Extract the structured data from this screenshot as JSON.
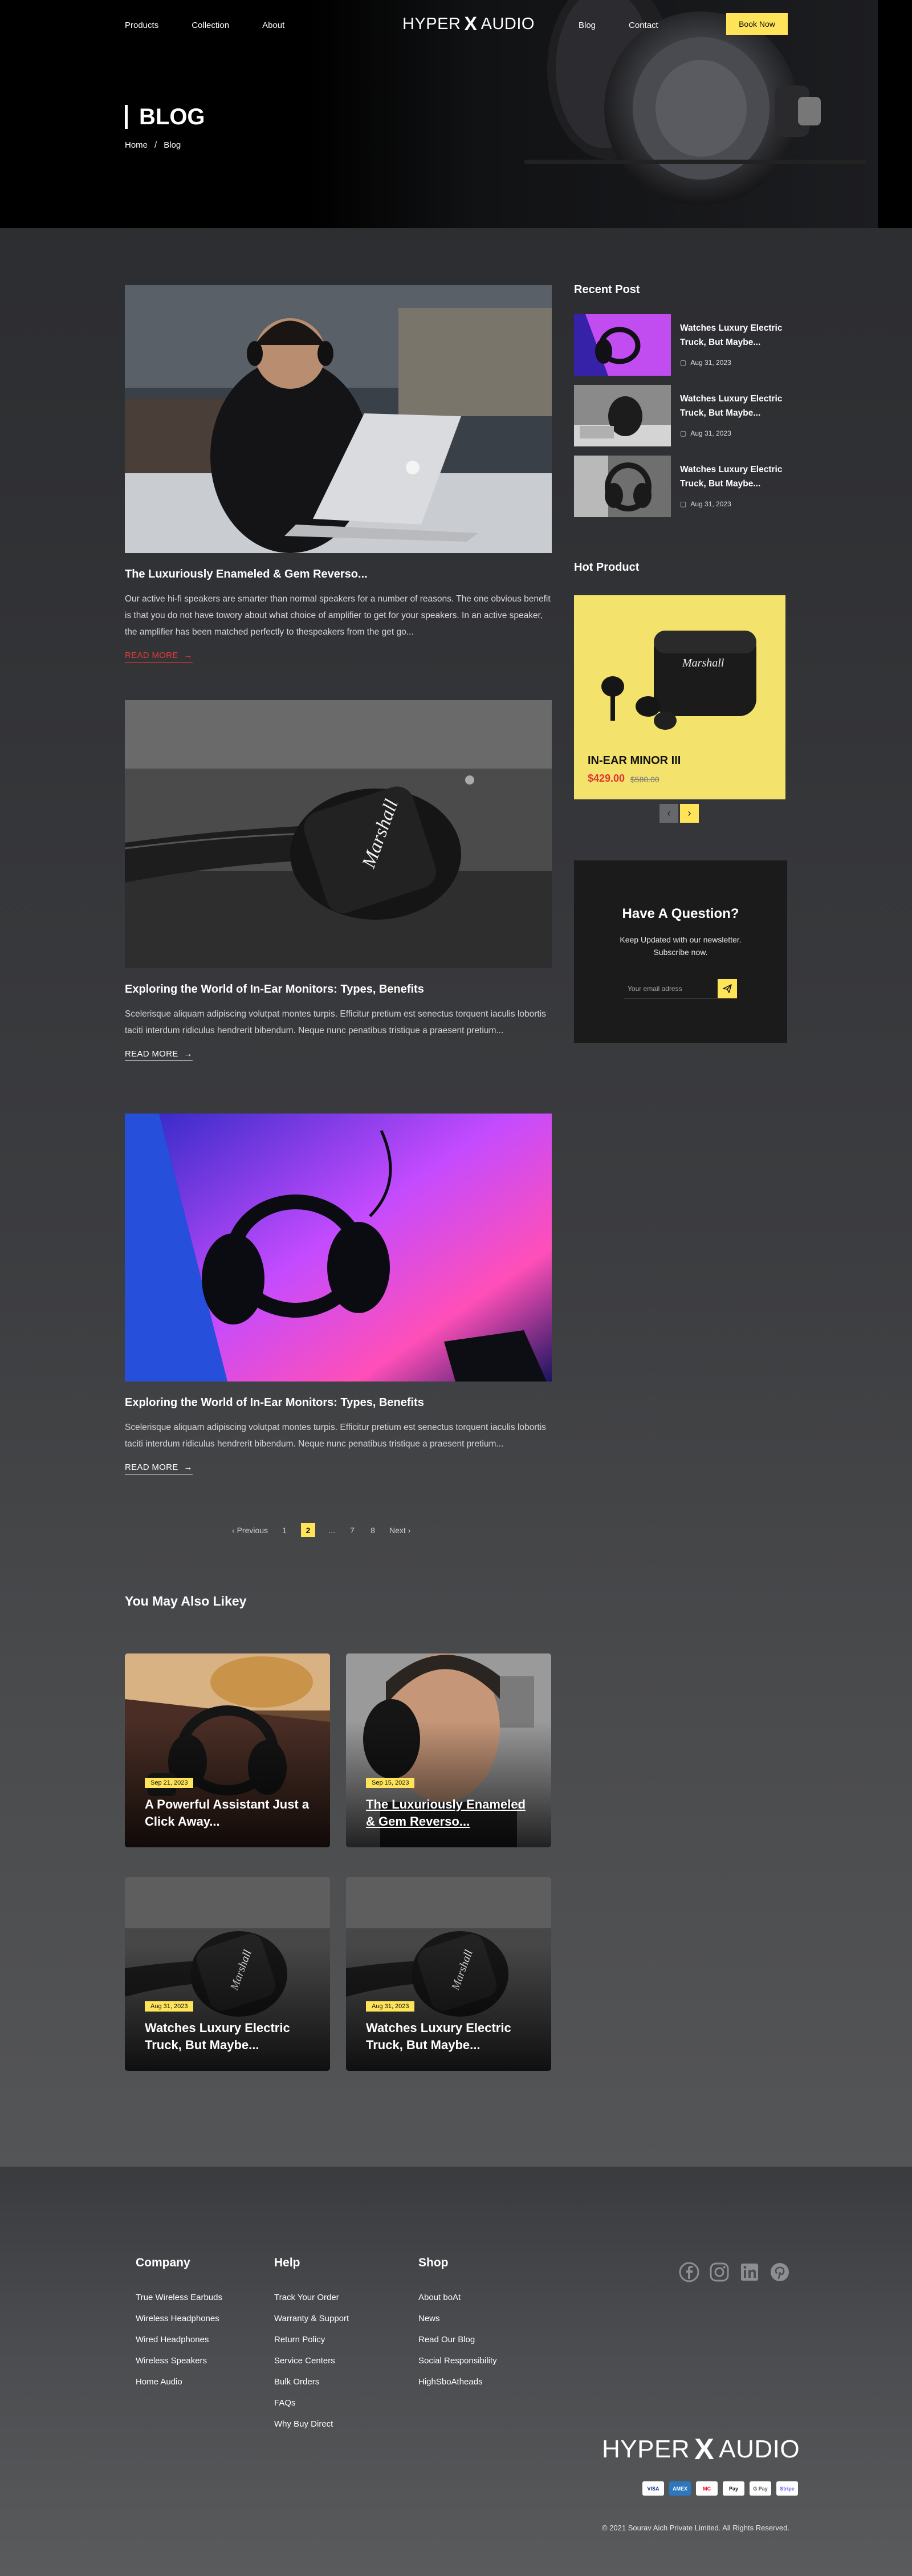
{
  "header": {
    "nav_left": [
      "Products",
      "Collection",
      "About"
    ],
    "nav_right": [
      "Blog",
      "Contact"
    ],
    "logo_left": "HYPER",
    "logo_mark": "X",
    "logo_right": "AUDIO",
    "cta": "Book Now"
  },
  "hero": {
    "title": "BLOG",
    "breadcrumb": [
      "Home",
      "/",
      "Blog"
    ]
  },
  "posts": [
    {
      "title": "The Luxuriously Enameled & Gem Reverso...",
      "excerpt": "Our active hi-fi speakers are smarter than normal speakers for a number of reasons. The one obvious benefit is that you do not have towory about what choice of amplifier to get for your speakers. In an active speaker, the amplifier has been matched perfectly to thespeakers from the get go...",
      "read_more": "READ MORE"
    },
    {
      "title": "Exploring the World of In-Ear Monitors: Types, Benefits",
      "excerpt": "Scelerisque aliquam adipiscing volutpat montes turpis. Efficitur pretium est senectus torquent iaculis lobortis taciti interdum ridiculus hendrerit bibendum. Neque nunc penatibus tristique a praesent pretium...",
      "read_more": "READ MORE"
    },
    {
      "title": "Exploring the World of In-Ear Monitors: Types, Benefits",
      "excerpt": "Scelerisque aliquam adipiscing volutpat montes turpis. Efficitur pretium est senectus torquent iaculis lobortis taciti interdum ridiculus hendrerit bibendum. Neque nunc penatibus tristique a praesent pretium...",
      "read_more": "READ MORE"
    }
  ],
  "pagination": {
    "previous": "Previous",
    "pages": [
      "1",
      "2",
      "...",
      "7",
      "8"
    ],
    "current": "2",
    "next": "Next"
  },
  "sidebar": {
    "recent_heading": "Recent Post",
    "recent": [
      {
        "title": "Watches Luxury Electric Truck, But Maybe...",
        "date": "Aug 31, 2023"
      },
      {
        "title": "Watches Luxury Electric Truck, But Maybe...",
        "date": "Aug 31, 2023"
      },
      {
        "title": "Watches Luxury Electric Truck, But Maybe...",
        "date": "Aug 31, 2023"
      }
    ],
    "hot_heading": "Hot  Product",
    "hot_product": {
      "name": "IN-EAR MINOR III",
      "price": "$429.00",
      "old_price": "$580.00",
      "brand": "Marshall"
    },
    "newsletter": {
      "title": "Have A Question?",
      "text": "Keep Updated with our newsletter. Subscribe now.",
      "placeholder": "Your email adress"
    }
  },
  "related": {
    "heading": "You May Also Likey",
    "cards": [
      {
        "date": "Sep 21, 2023",
        "title": "A Powerful Assistant Just a Click Away..."
      },
      {
        "date": "Sep 15, 2023",
        "title": "The Luxuriously Enameled & Gem Reverso..."
      },
      {
        "date": "Aug 31, 2023",
        "title": "Watches Luxury Electric Truck, But Maybe..."
      },
      {
        "date": "Aug 31, 2023",
        "title": "Watches Luxury Electric Truck, But Maybe..."
      }
    ]
  },
  "footer": {
    "columns": [
      {
        "heading": "Company",
        "links": [
          "True Wireless Earbuds",
          "Wireless Headphones",
          "Wired Headphones",
          "Wireless Speakers",
          "Home Audio"
        ]
      },
      {
        "heading": "Help",
        "links": [
          "Track Your Order",
          "Warranty & Support",
          "Return Policy",
          "Service Centers",
          "Bulk Orders",
          "FAQs",
          "Why Buy Direct"
        ]
      },
      {
        "heading": "Shop",
        "links": [
          "About boAt",
          "News",
          "Read Our Blog",
          "Social Responsibility",
          "HighSboAtheads"
        ]
      }
    ],
    "socials": [
      "facebook-icon",
      "instagram-icon",
      "linkedin-icon",
      "pinterest-icon"
    ],
    "payments": [
      "VISA",
      "AMEX",
      "MC",
      "Pay",
      "G Pay",
      "Stripe"
    ],
    "copyright": "© 2021 Sourav Aich Private Limited. All Rights Reserved."
  },
  "colors": {
    "accent": "#ffe45a",
    "sale": "#e03434",
    "dark": "#1b1b1c"
  }
}
